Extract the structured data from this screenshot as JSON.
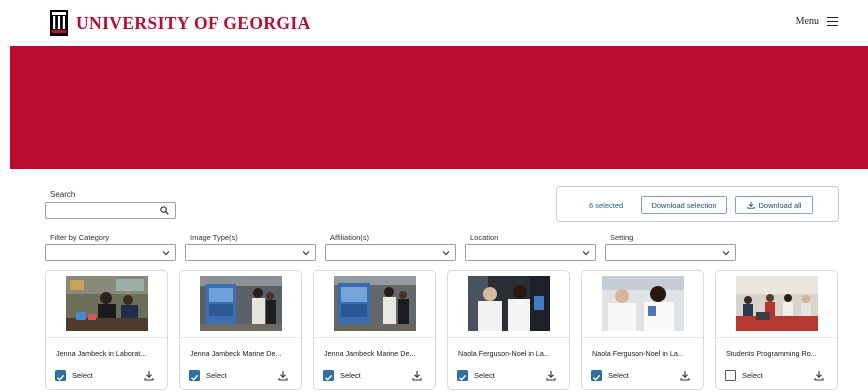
{
  "header": {
    "logo_text": "UNIVERSITY OF GEORGIA",
    "menu_label": "Menu",
    "brand_color": "#ba0c2f"
  },
  "search": {
    "label": "Search",
    "value": "",
    "placeholder": ""
  },
  "selection": {
    "count_text": "6 selected",
    "download_selection_label": "Download selection",
    "download_all_label": "Download all"
  },
  "filters": [
    {
      "label": "Filter by Category",
      "value": ""
    },
    {
      "label": "Image Type(s)",
      "value": ""
    },
    {
      "label": "Affiliation(s)",
      "value": ""
    },
    {
      "label": "Location",
      "value": ""
    },
    {
      "label": "Setting",
      "value": ""
    }
  ],
  "cards": [
    {
      "title": "Jenna Jambeck in Laborat...",
      "select_label": "Select",
      "checked": true
    },
    {
      "title": "Jenna Jambeck Marine De...",
      "select_label": "Select",
      "checked": true
    },
    {
      "title": "Jenna Jambeck Marine De...",
      "select_label": "Select",
      "checked": true
    },
    {
      "title": "Naola Ferguson-Noel in La...",
      "select_label": "Select",
      "checked": true
    },
    {
      "title": "Naola Ferguson-Noel in La...",
      "select_label": "Select",
      "checked": true
    },
    {
      "title": "Students Programming Ro...",
      "select_label": "Select",
      "checked": false
    }
  ]
}
